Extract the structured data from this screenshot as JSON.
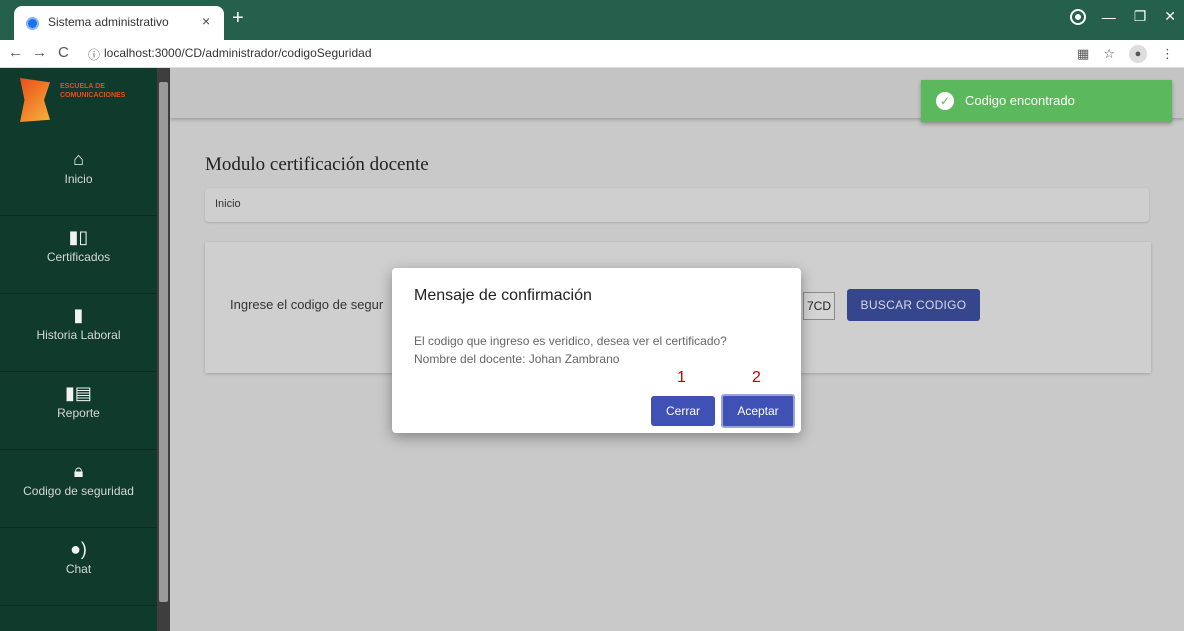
{
  "browser": {
    "tab_title": "Sistema administrativo",
    "tab_close": "×",
    "new_tab": "+",
    "url_prefix": "ⓘ",
    "url": "localhost:3000/CD/administrador/codigoSeguridad"
  },
  "sidebar": {
    "logo_text": "ESCUELA DE COMUNICACIONES",
    "items": [
      {
        "label": "Inicio",
        "icon": "home-icon"
      },
      {
        "label": "Certificados",
        "icon": "book-icon"
      },
      {
        "label": "Historia Laboral",
        "icon": "bookmark-icon"
      },
      {
        "label": "Reporte",
        "icon": "open-book-icon"
      },
      {
        "label": "Codigo de seguridad",
        "icon": "lock-icon"
      },
      {
        "label": "Chat",
        "icon": "chat-icon"
      }
    ]
  },
  "main": {
    "page_title": "Modulo certificación docente",
    "breadcrumb": "Inicio",
    "code_label": "Ingrese el codigo de segur",
    "code_value": "7CD",
    "search_button": "BUSCAR CODIGO"
  },
  "toast": {
    "message": "Codigo encontrado",
    "color": "#5cb85c"
  },
  "modal": {
    "title": "Mensaje de confirmación",
    "line1": "El codigo que ingreso es veridico, desea ver el certificado?",
    "line2": "Nombre del docente: Johan Zambrano",
    "annotation_1": "1",
    "annotation_2": "2",
    "cancel_label": "Cerrar",
    "accept_label": "Aceptar",
    "button_color": "#3f51b5"
  }
}
